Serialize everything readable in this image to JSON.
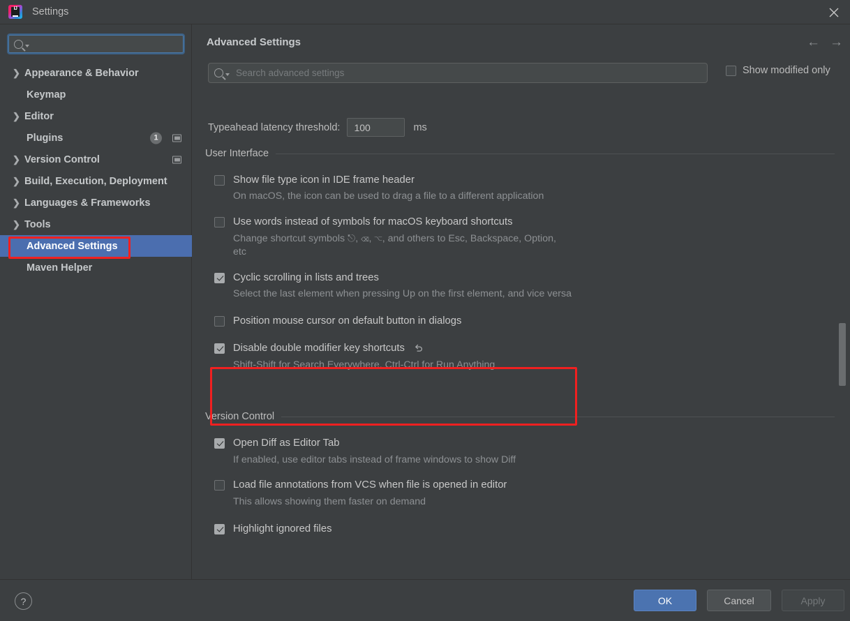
{
  "window": {
    "title": "Settings",
    "app_icon": "intellij-idea-logo",
    "close_icon": "close-icon"
  },
  "sidebar": {
    "search": {
      "value": "",
      "placeholder": "",
      "icon": "search-icon"
    },
    "items": [
      {
        "label": "Appearance & Behavior",
        "expandable": true,
        "selected": false
      },
      {
        "label": "Keymap",
        "expandable": false,
        "selected": false
      },
      {
        "label": "Editor",
        "expandable": true,
        "selected": false
      },
      {
        "label": "Plugins",
        "expandable": false,
        "selected": false,
        "badge": "1",
        "window_icon": true
      },
      {
        "label": "Version Control",
        "expandable": true,
        "selected": false,
        "window_icon": true
      },
      {
        "label": "Build, Execution, Deployment",
        "expandable": true,
        "selected": false
      },
      {
        "label": "Languages & Frameworks",
        "expandable": true,
        "selected": false
      },
      {
        "label": "Tools",
        "expandable": true,
        "selected": false
      },
      {
        "label": "Advanced Settings",
        "expandable": false,
        "selected": true
      },
      {
        "label": "Maven Helper",
        "expandable": false,
        "selected": false
      }
    ]
  },
  "main": {
    "title": "Advanced Settings",
    "back_icon": "arrow-left-icon",
    "forward_icon": "arrow-right-icon",
    "search": {
      "value": "",
      "placeholder": "Search advanced settings",
      "icon": "search-icon"
    },
    "show_modified_only": {
      "label": "Show modified only",
      "checked": false
    },
    "typeahead": {
      "label": "Typeahead latency threshold:",
      "value": "100",
      "unit": "ms"
    },
    "sections": [
      {
        "title": "User Interface",
        "options": [
          {
            "label": "Show file type icon in IDE frame header",
            "description": "On macOS, the icon can be used to drag a file to a different application",
            "checked": false,
            "undo": false
          },
          {
            "label": "Use words instead of symbols for macOS keyboard shortcuts",
            "description": "Change shortcut symbols ⎋, ⌫, ⌥, and others to Esc, Backspace, Option, etc",
            "checked": false,
            "undo": false
          },
          {
            "label": "Cyclic scrolling in lists and trees",
            "description": "Select the last element when pressing Up on the first element, and vice versa",
            "checked": true,
            "undo": false
          },
          {
            "label": "Position mouse cursor on default button in dialogs",
            "description": "",
            "checked": false,
            "undo": false
          },
          {
            "label": "Disable double modifier key shortcuts",
            "description": "Shift-Shift for Search Everywhere, Ctrl-Ctrl for Run Anything",
            "checked": true,
            "undo": true,
            "highlighted": true
          }
        ]
      },
      {
        "title": "Version Control",
        "options": [
          {
            "label": "Open Diff as Editor Tab",
            "description": "If enabled, use editor tabs instead of frame windows to show Diff",
            "checked": true,
            "undo": false
          },
          {
            "label": "Load file annotations from VCS when file is opened in editor",
            "description": "This allows showing them faster on demand",
            "checked": false,
            "undo": false
          },
          {
            "label": "Highlight ignored files",
            "description": "",
            "checked": true,
            "undo": false
          }
        ]
      }
    ]
  },
  "footer": {
    "help_label": "?",
    "ok_label": "OK",
    "cancel_label": "Cancel",
    "apply_label": "Apply"
  },
  "annotations": {
    "accent_color": "#f02020",
    "selection_color": "#4b6eaf",
    "primary_button_color": "#4b73b0"
  }
}
